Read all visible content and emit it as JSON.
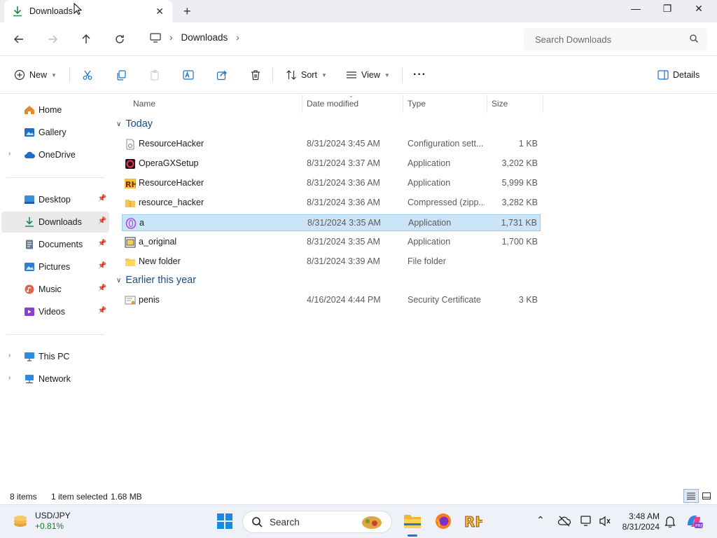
{
  "window": {
    "tab_title": "Downloads",
    "new_tab_symbol": "+",
    "close_tab_symbol": "✕",
    "minimize_symbol": "—",
    "maximize_symbol": "❐",
    "close_symbol": "✕"
  },
  "address": {
    "breadcrumb": [
      "Downloads"
    ],
    "search_placeholder": "Search Downloads"
  },
  "commands": {
    "new_label": "New",
    "sort_label": "Sort",
    "view_label": "View",
    "more_label": "···",
    "details_label": "Details"
  },
  "sidebar": {
    "items": [
      {
        "label": "Home",
        "icon": "home-icon"
      },
      {
        "label": "Gallery",
        "icon": "gallery-icon"
      },
      {
        "label": "OneDrive",
        "icon": "cloud-icon"
      },
      {
        "label": "Desktop",
        "icon": "desktop-icon"
      },
      {
        "label": "Downloads",
        "icon": "download-icon",
        "selected": true
      },
      {
        "label": "Documents",
        "icon": "documents-icon"
      },
      {
        "label": "Pictures",
        "icon": "pictures-icon"
      },
      {
        "label": "Music",
        "icon": "music-icon"
      },
      {
        "label": "Videos",
        "icon": "videos-icon"
      },
      {
        "label": "This PC",
        "icon": "pc-icon"
      },
      {
        "label": "Network",
        "icon": "network-icon"
      }
    ]
  },
  "columns": {
    "name": "Name",
    "date": "Date modified",
    "type": "Type",
    "size": "Size"
  },
  "groups": [
    {
      "label": "Today",
      "files": [
        {
          "name": "ResourceHacker",
          "date": "8/31/2024 3:45 AM",
          "type": "Configuration sett...",
          "size": "1 KB",
          "icon": "config-file-icon"
        },
        {
          "name": "OperaGXSetup",
          "date": "8/31/2024 3:37 AM",
          "type": "Application",
          "size": "3,202 KB",
          "icon": "opera-gx-icon"
        },
        {
          "name": "ResourceHacker",
          "date": "8/31/2024 3:36 AM",
          "type": "Application",
          "size": "5,999 KB",
          "icon": "resource-hacker-icon"
        },
        {
          "name": "resource_hacker",
          "date": "8/31/2024 3:36 AM",
          "type": "Compressed (zipp...",
          "size": "3,282 KB",
          "icon": "zip-folder-icon"
        },
        {
          "name": "a",
          "date": "8/31/2024 3:35 AM",
          "type": "Application",
          "size": "1,731 KB",
          "icon": "opera-icon",
          "selected": true
        },
        {
          "name": "a_original",
          "date": "8/31/2024 3:35 AM",
          "type": "Application",
          "size": "1,700 KB",
          "icon": "exe-icon"
        },
        {
          "name": "New folder",
          "date": "8/31/2024 3:39 AM",
          "type": "File folder",
          "size": "",
          "icon": "folder-icon"
        }
      ]
    },
    {
      "label": "Earlier this year",
      "files": [
        {
          "name": "penis",
          "date": "4/16/2024 4:44 PM",
          "type": "Security Certificate",
          "size": "3 KB",
          "icon": "certificate-icon"
        }
      ]
    }
  ],
  "status": {
    "items_count": "8 items",
    "selection": "1 item selected",
    "selection_size": "1.68 MB"
  },
  "taskbar": {
    "ticker_name": "USD/JPY",
    "ticker_change": "+0.81%",
    "search_label": "Search",
    "time": "3:48 AM",
    "date": "8/31/2024"
  },
  "colors": {
    "accent": "#1a73d9",
    "selection_bg": "#cce4f7",
    "group_header": "#1a4e8a"
  }
}
